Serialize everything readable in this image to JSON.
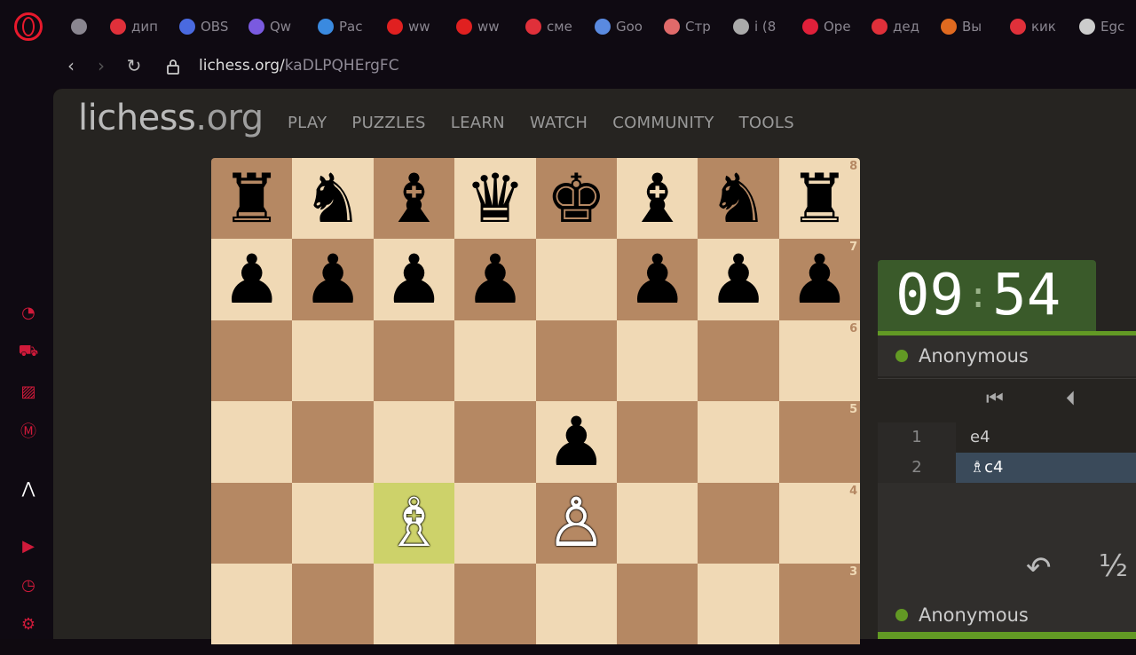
{
  "browser": {
    "tabs": [
      {
        "icon": "game-controller-icon",
        "label": "",
        "color": "#8a8690"
      },
      {
        "icon": "yandex-icon",
        "label": "дип",
        "color": "#e0303a"
      },
      {
        "icon": "obs-icon",
        "label": "OBS",
        "color": "#4a6ae0"
      },
      {
        "icon": "qwen-icon",
        "label": "Qw",
        "color": "#7a5ae0"
      },
      {
        "icon": "m-icon",
        "label": "Рас",
        "color": "#3a8ae0"
      },
      {
        "icon": "youtube-icon",
        "label": "ww",
        "color": "#e02020"
      },
      {
        "icon": "youtube-icon",
        "label": "ww",
        "color": "#e02020"
      },
      {
        "icon": "yandex-icon",
        "label": "сме",
        "color": "#e0303a"
      },
      {
        "icon": "gemini-icon",
        "label": "Goo",
        "color": "#5a8ae0"
      },
      {
        "icon": "photo-icon",
        "label": "Стр",
        "color": "#e06a6a"
      },
      {
        "icon": "document-icon",
        "label": "i (8",
        "color": "#aaa"
      },
      {
        "icon": "opera-icon",
        "label": "Ope",
        "color": "#e0203a"
      },
      {
        "icon": "yandex-icon",
        "label": "дед",
        "color": "#e0303a"
      },
      {
        "icon": "k-icon",
        "label": "Вы",
        "color": "#e06a20"
      },
      {
        "icon": "yandex-icon",
        "label": "кик",
        "color": "#e0303a"
      },
      {
        "icon": "github-icon",
        "label": "Egc",
        "color": "#ccc"
      }
    ],
    "url_host": "lichess.org/",
    "url_path": "kaDLPQHErgFC"
  },
  "site": {
    "logo_main": "lichess",
    "logo_tld": ".org",
    "nav": [
      "PLAY",
      "PUZZLES",
      "LEARN",
      "WATCH",
      "COMMUNITY",
      "TOOLS"
    ]
  },
  "board": {
    "ranks_visible": [
      "8",
      "7",
      "6",
      "5",
      "4",
      "3"
    ],
    "highlight_square": "c4",
    "pieces": [
      {
        "sq": "a8",
        "p": "♜",
        "c": "b"
      },
      {
        "sq": "b8",
        "p": "♞",
        "c": "b"
      },
      {
        "sq": "c8",
        "p": "♝",
        "c": "b"
      },
      {
        "sq": "d8",
        "p": "♛",
        "c": "b"
      },
      {
        "sq": "e8",
        "p": "♚",
        "c": "b"
      },
      {
        "sq": "f8",
        "p": "♝",
        "c": "b"
      },
      {
        "sq": "g8",
        "p": "♞",
        "c": "b"
      },
      {
        "sq": "h8",
        "p": "♜",
        "c": "b"
      },
      {
        "sq": "a7",
        "p": "♟",
        "c": "b"
      },
      {
        "sq": "b7",
        "p": "♟",
        "c": "b"
      },
      {
        "sq": "c7",
        "p": "♟",
        "c": "b"
      },
      {
        "sq": "d7",
        "p": "♟",
        "c": "b"
      },
      {
        "sq": "f7",
        "p": "♟",
        "c": "b"
      },
      {
        "sq": "g7",
        "p": "♟",
        "c": "b"
      },
      {
        "sq": "h7",
        "p": "♟",
        "c": "b"
      },
      {
        "sq": "e5",
        "p": "♟",
        "c": "b"
      },
      {
        "sq": "c4",
        "p": "♗",
        "c": "w"
      },
      {
        "sq": "e4",
        "p": "♙",
        "c": "w"
      }
    ]
  },
  "clock": {
    "minutes": "09",
    "seconds": "54"
  },
  "players": {
    "top": "Anonymous",
    "bottom": "Anonymous"
  },
  "moves": [
    {
      "num": "1",
      "move": "e4",
      "current": false
    },
    {
      "num": "2",
      "move": "♗c4",
      "current": true
    }
  ],
  "actions": {
    "undo": "↶",
    "draw": "½"
  }
}
